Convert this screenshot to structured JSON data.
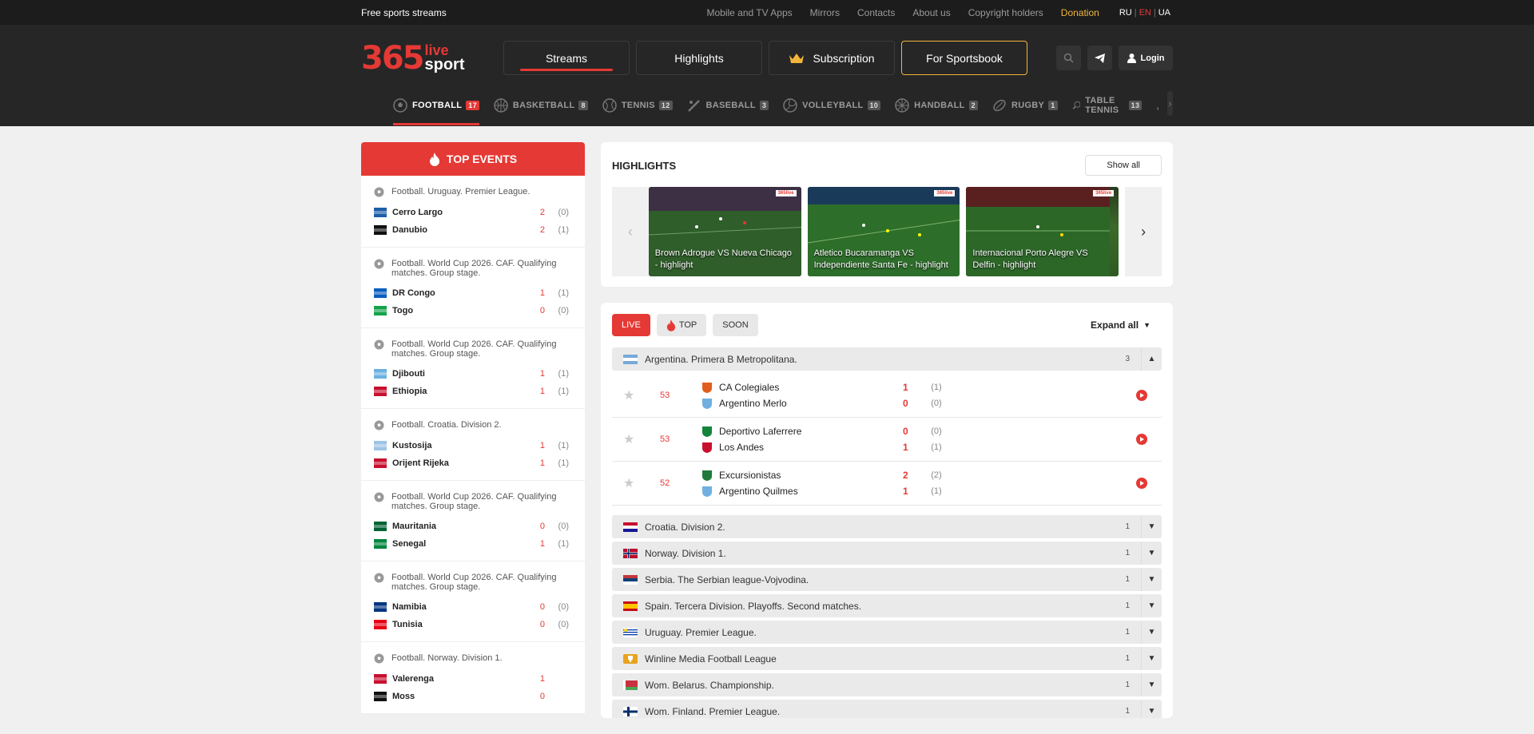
{
  "topbar": {
    "brand": "Free sports streams",
    "links": [
      "Mobile and TV Apps",
      "Mirrors",
      "Contacts",
      "About us",
      "Copyright holders"
    ],
    "donation": "Donation",
    "langs": [
      "RU",
      "EN",
      "UA"
    ]
  },
  "header": {
    "logo": {
      "number": "365",
      "live": "live",
      "sport": "sport"
    },
    "nav": {
      "streams": "Streams",
      "highlights": "Highlights",
      "subscription": "Subscription",
      "sportsbook": "For Sportsbook"
    },
    "login": "Login"
  },
  "sports": [
    {
      "label": "FOOTBALL",
      "count": "17",
      "icon": "football-icon"
    },
    {
      "label": "BASKETBALL",
      "count": "8",
      "icon": "basketball-icon"
    },
    {
      "label": "TENNIS",
      "count": "12",
      "icon": "tennis-icon"
    },
    {
      "label": "BASEBALL",
      "count": "3",
      "icon": "baseball-icon"
    },
    {
      "label": "VOLLEYBALL",
      "count": "10",
      "icon": "volleyball-icon"
    },
    {
      "label": "HANDBALL",
      "count": "2",
      "icon": "handball-icon"
    },
    {
      "label": "RUGBY",
      "count": "1",
      "icon": "rugby-icon"
    },
    {
      "label": "TABLE TENNIS",
      "count": "13",
      "icon": "table-tennis-icon"
    }
  ],
  "sports_more": ",",
  "top_events": {
    "title": "TOP EVENTS",
    "items": [
      {
        "league": "Football. Uruguay. Premier League.",
        "teams": [
          {
            "name": "Cerro Largo",
            "score": "2",
            "ht": "(0)"
          },
          {
            "name": "Danubio",
            "score": "2",
            "ht": "(1)"
          }
        ]
      },
      {
        "league": "Football. World Cup 2026. CAF. Qualifying matches. Group stage.",
        "teams": [
          {
            "name": "DR Congo",
            "score": "1",
            "ht": "(1)"
          },
          {
            "name": "Togo",
            "score": "0",
            "ht": "(0)"
          }
        ]
      },
      {
        "league": "Football. World Cup 2026. CAF. Qualifying matches. Group stage.",
        "teams": [
          {
            "name": "Djibouti",
            "score": "1",
            "ht": "(1)"
          },
          {
            "name": "Ethiopia",
            "score": "1",
            "ht": "(1)"
          }
        ]
      },
      {
        "league": "Football. Croatia. Division 2.",
        "teams": [
          {
            "name": "Kustosija",
            "score": "1",
            "ht": "(1)"
          },
          {
            "name": "Orijent Rijeka",
            "score": "1",
            "ht": "(1)"
          }
        ]
      },
      {
        "league": "Football. World Cup 2026. CAF. Qualifying matches. Group stage.",
        "teams": [
          {
            "name": "Mauritania",
            "score": "0",
            "ht": "(0)"
          },
          {
            "name": "Senegal",
            "score": "1",
            "ht": "(1)"
          }
        ]
      },
      {
        "league": "Football. World Cup 2026. CAF. Qualifying matches. Group stage.",
        "teams": [
          {
            "name": "Namibia",
            "score": "0",
            "ht": "(0)"
          },
          {
            "name": "Tunisia",
            "score": "0",
            "ht": "(0)"
          }
        ]
      },
      {
        "league": "Football. Norway. Division 1.",
        "teams": [
          {
            "name": "Valerenga",
            "score": "1",
            "ht": ""
          },
          {
            "name": "Moss",
            "score": "0",
            "ht": ""
          }
        ]
      }
    ]
  },
  "highlights": {
    "title": "HIGHLIGHTS",
    "show_all": "Show all",
    "items": [
      {
        "caption": "Brown Adrogue VS Nueva Chicago - highlight"
      },
      {
        "caption": "Atletico Bucaramanga VS Independiente Santa Fe - highlight"
      },
      {
        "caption": "Internacional Porto Alegre VS Delfin - highlight"
      }
    ]
  },
  "live": {
    "filters": {
      "live": "LIVE",
      "top": "TOP",
      "soon": "SOON"
    },
    "expand_all": "Expand all",
    "open_league": {
      "name": "Argentina. Primera B Metropolitana.",
      "count": "3"
    },
    "matches": [
      {
        "minute": "53",
        "home": "CA Colegiales",
        "away": "Argentino Merlo",
        "hs": "1",
        "as": "0",
        "hht": "(1)",
        "aht": "(0)"
      },
      {
        "minute": "53",
        "home": "Deportivo Laferrere",
        "away": "Los Andes",
        "hs": "0",
        "as": "1",
        "hht": "(0)",
        "aht": "(1)"
      },
      {
        "minute": "52",
        "home": "Excursionistas",
        "away": "Argentino Quilmes",
        "hs": "2",
        "as": "1",
        "hht": "(2)",
        "aht": "(1)"
      }
    ],
    "leagues": [
      {
        "name": "Croatia. Division 2.",
        "count": "1"
      },
      {
        "name": "Norway. Division 1.",
        "count": "1"
      },
      {
        "name": "Serbia. The Serbian league-Vojvodina.",
        "count": "1"
      },
      {
        "name": "Spain. Tercera Division. Playoffs. Second matches.",
        "count": "1"
      },
      {
        "name": "Uruguay. Premier League.",
        "count": "1"
      },
      {
        "name": "Winline Media Football League",
        "count": "1"
      },
      {
        "name": "Wom. Belarus. Championship.",
        "count": "1"
      },
      {
        "name": "Wom. Finland. Premier League.",
        "count": "1"
      }
    ]
  },
  "colors": {
    "accent": "#e53935",
    "gold": "#f2b53c",
    "header_bg": "#262626",
    "topbar_bg": "#1c1c1c"
  }
}
